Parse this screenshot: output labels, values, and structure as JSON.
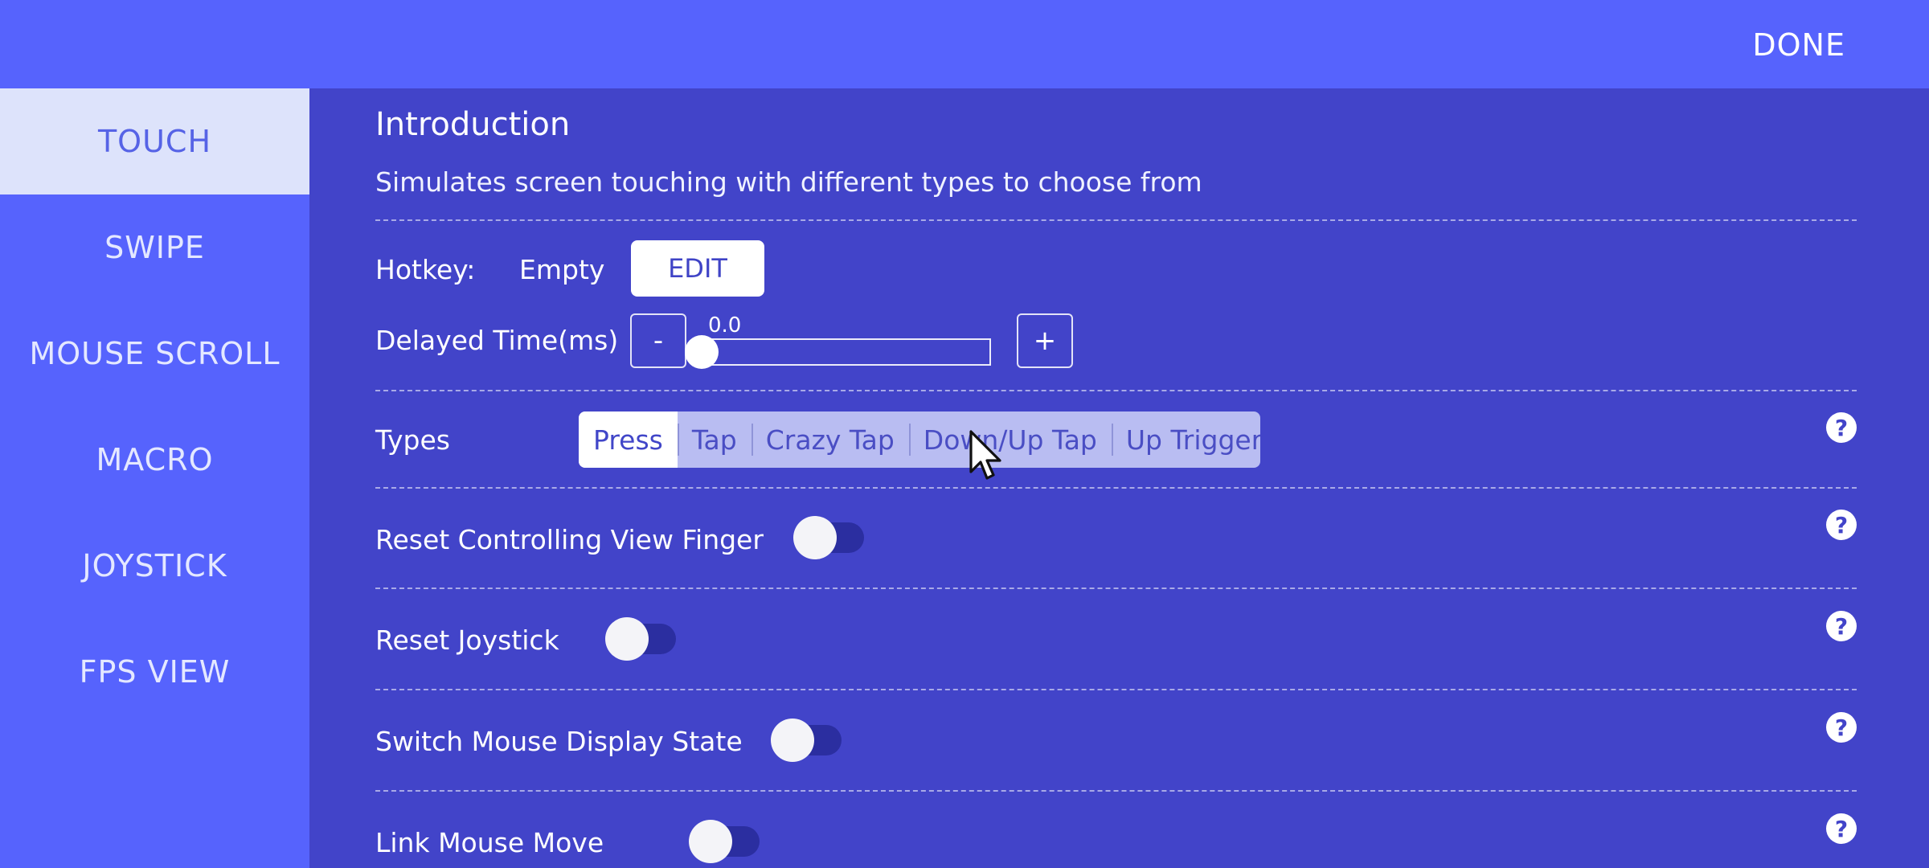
{
  "topbar": {
    "done_label": "DONE"
  },
  "sidebar": {
    "items": [
      {
        "label": "TOUCH",
        "active": true
      },
      {
        "label": "SWIPE"
      },
      {
        "label": "MOUSE SCROLL"
      },
      {
        "label": "MACRO"
      },
      {
        "label": "JOYSTICK"
      },
      {
        "label": "FPS VIEW"
      }
    ]
  },
  "intro": {
    "title": "Introduction",
    "description": "Simulates screen touching with different types to choose from"
  },
  "hotkey": {
    "label": "Hotkey:",
    "value": "Empty",
    "edit_label": "EDIT"
  },
  "delay": {
    "label": "Delayed Time(ms)",
    "minus": "-",
    "plus": "+",
    "value": "0.0"
  },
  "types": {
    "label": "Types",
    "options": [
      "Press",
      "Tap",
      "Crazy Tap",
      "Down/Up Tap",
      "Up Trigger"
    ],
    "selected": "Press"
  },
  "toggles": [
    {
      "label": "Reset Controlling View Finger",
      "on": false
    },
    {
      "label": "Reset Joystick",
      "on": false
    },
    {
      "label": "Switch Mouse Display State",
      "on": false
    },
    {
      "label": "Link Mouse Move",
      "on": false
    }
  ],
  "help_glyph": "?",
  "colors": {
    "background": "#4244c9",
    "topbar": "#5663fd",
    "sidebar_active": "#dde3fb",
    "segment_bg": "#b9bdf2"
  },
  "icons": {
    "help": "question-circle-icon",
    "cursor": "mouse-pointer-icon"
  }
}
